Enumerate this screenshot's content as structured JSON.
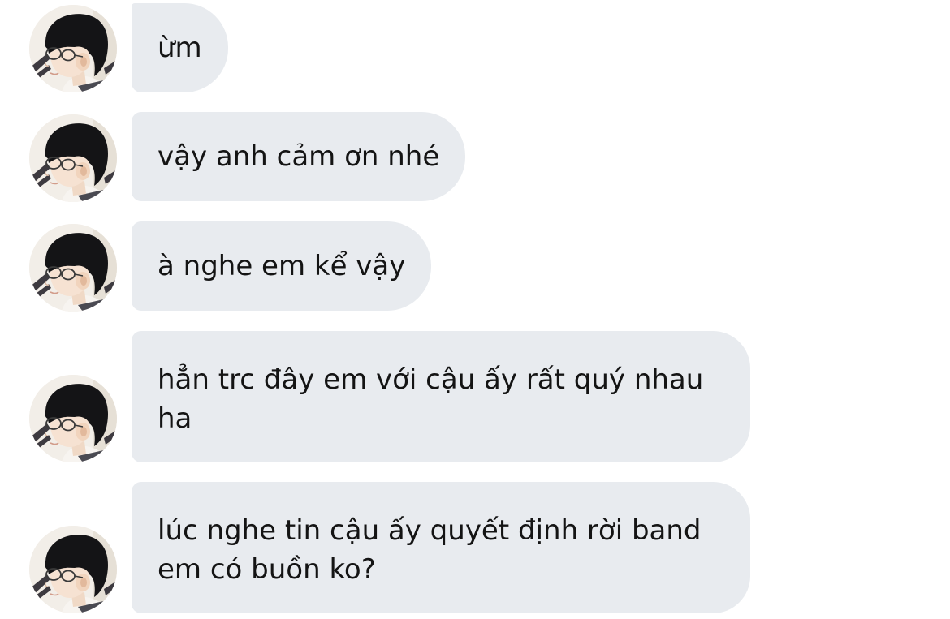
{
  "conversation": {
    "messages": [
      {
        "sender": "other",
        "text": "ừm",
        "avatar": "profile-photo"
      },
      {
        "sender": "other",
        "text": "vậy anh cảm ơn nhé",
        "avatar": "profile-photo"
      },
      {
        "sender": "other",
        "text": "à nghe em kể vậy",
        "avatar": "profile-photo"
      },
      {
        "sender": "other",
        "text": "hẳn trc đây em với cậu ấy rất quý nhau ha",
        "avatar": "profile-photo"
      },
      {
        "sender": "other",
        "text": "lúc nghe tin cậu ấy quyết định rời band em có buồn ko?",
        "avatar": "profile-photo"
      }
    ]
  },
  "colors": {
    "background": "#ffffff",
    "bubble": "#e8ebef",
    "text": "#141414"
  }
}
